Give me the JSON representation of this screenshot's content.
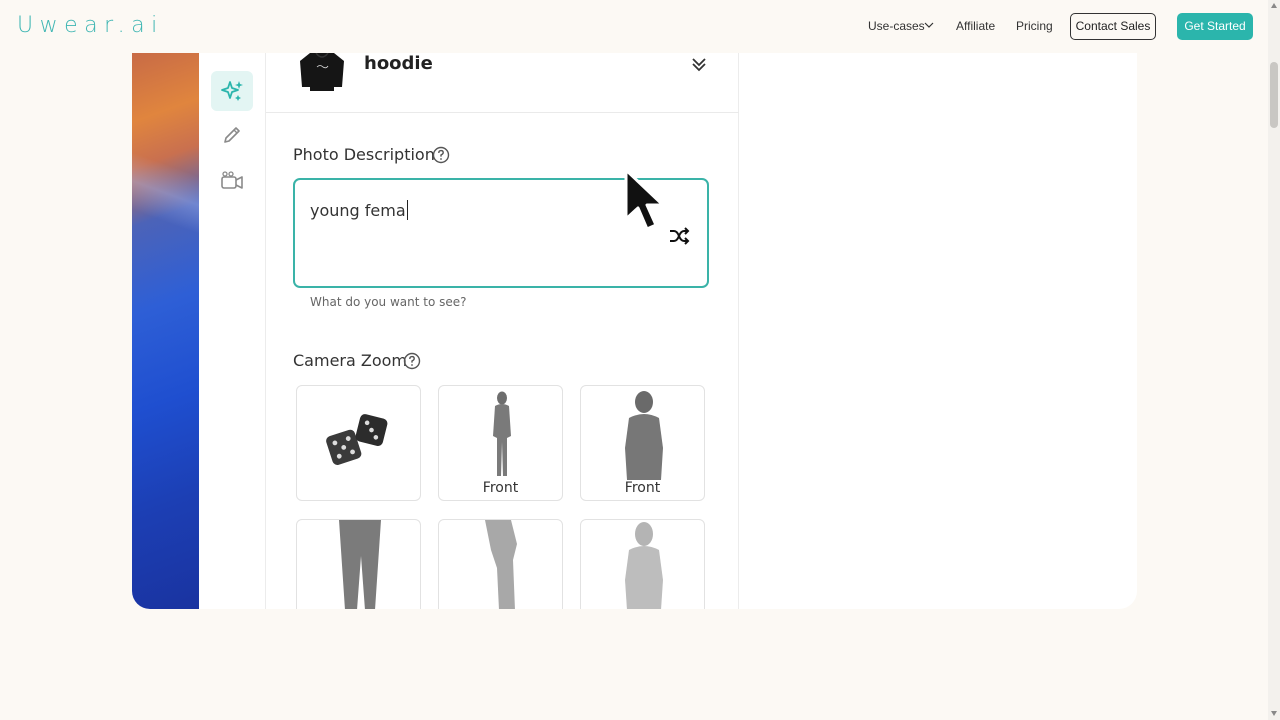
{
  "header": {
    "logo_text": "Uwear.ai",
    "nav": {
      "use_cases": "Use-cases",
      "affiliate": "Affiliate",
      "pricing": "Pricing"
    },
    "contact_sales": "Contact Sales",
    "get_started": "Get Started"
  },
  "demo": {
    "product_name": "hoodie",
    "photo_description": {
      "label": "Photo Description",
      "value": "young fema",
      "hint": "What do you want to see?"
    },
    "camera_zoom": {
      "label": "Camera Zoom",
      "options": [
        {
          "label": "",
          "icon": "dice-icon"
        },
        {
          "label": "Front",
          "icon": "full-body-figure-icon"
        },
        {
          "label": "Front",
          "icon": "half-body-figure-icon"
        },
        {
          "label": "",
          "icon": "legs-figure-icon"
        },
        {
          "label": "",
          "icon": "side-figure-icon"
        },
        {
          "label": "",
          "icon": "back-figure-icon"
        }
      ]
    }
  },
  "colors": {
    "accent": "#2bb5ac",
    "background": "#fcf9f4",
    "input_border": "#3ab3a8"
  }
}
